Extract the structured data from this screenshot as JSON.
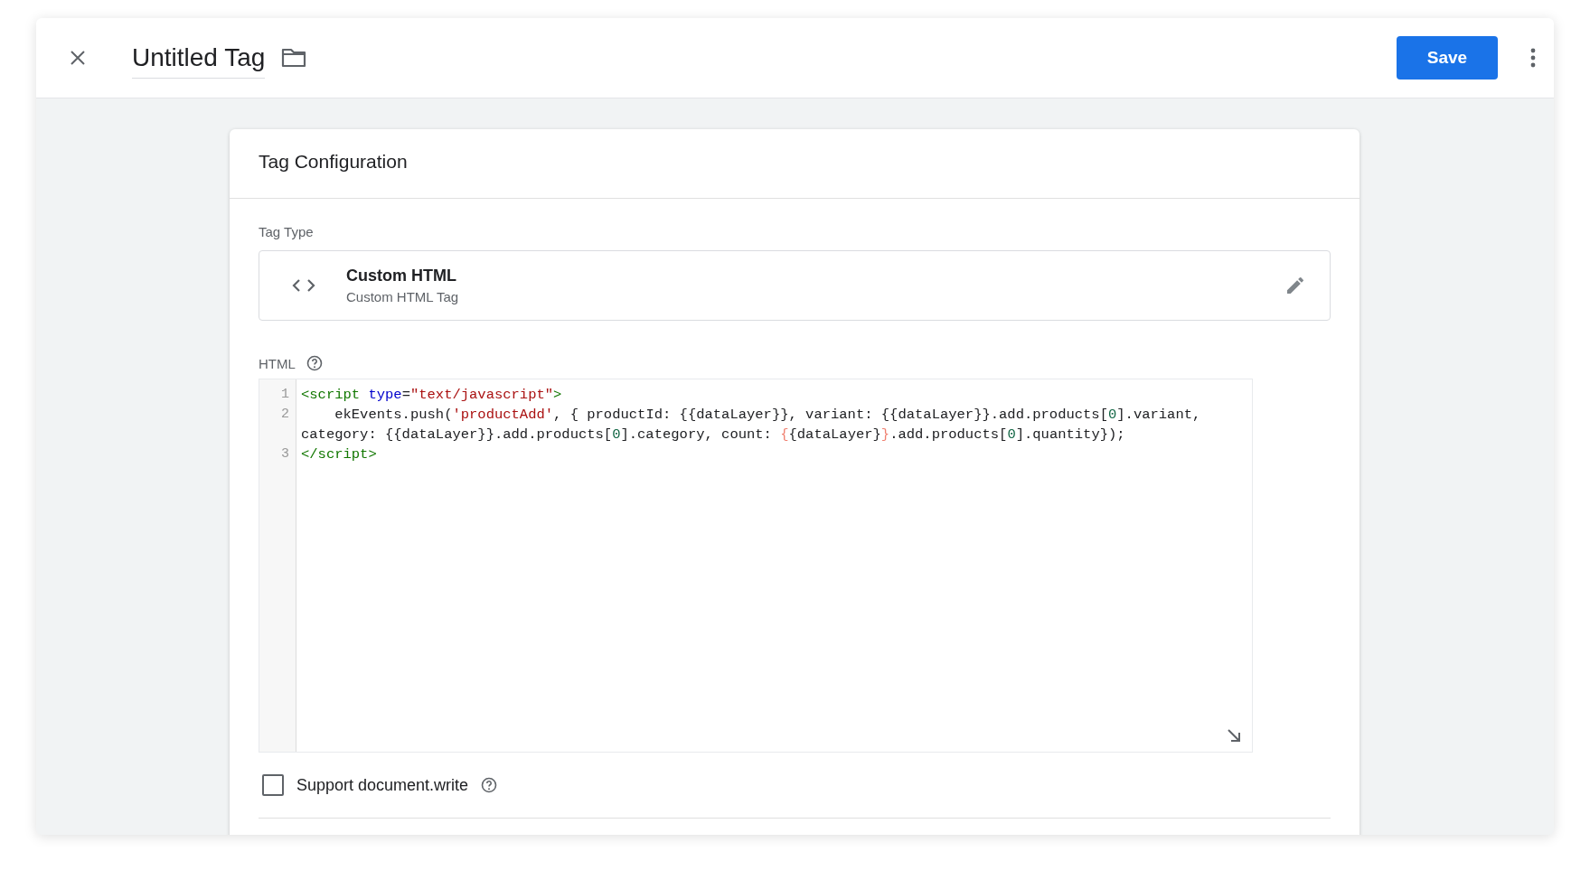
{
  "header": {
    "title": "Untitled Tag",
    "save_label": "Save"
  },
  "card": {
    "title": "Tag Configuration",
    "tag_type_label": "Tag Type",
    "tag_type": {
      "name": "Custom HTML",
      "description": "Custom HTML Tag"
    },
    "html_label": "HTML",
    "code_lines": [
      {
        "number": "1",
        "rows": [
          {
            "tokens": [
              {
                "kind": "tag",
                "text": "<script "
              },
              {
                "kind": "attr",
                "text": "type"
              },
              {
                "kind": "plain",
                "text": "="
              },
              {
                "kind": "string",
                "text": "\"text/javascript\""
              },
              {
                "kind": "tag",
                "text": ">"
              }
            ]
          }
        ]
      },
      {
        "number": "2",
        "rows": [
          {
            "tokens": [
              {
                "kind": "plain",
                "text": "    ekEvents.push("
              },
              {
                "kind": "string",
                "text": "'productAdd'"
              },
              {
                "kind": "plain",
                "text": ", { productId: {{dataLayer}}, variant: {{dataLayer}}.add.products["
              },
              {
                "kind": "number",
                "text": "0"
              },
              {
                "kind": "plain",
                "text": "].variant,"
              }
            ]
          },
          {
            "tokens": [
              {
                "kind": "plain",
                "text": "category: {{dataLayer}}.add.products["
              },
              {
                "kind": "number",
                "text": "0"
              },
              {
                "kind": "plain",
                "text": "].category, count: "
              },
              {
                "kind": "mismatch",
                "text": "{"
              },
              {
                "kind": "plain",
                "text": "{dataLayer}"
              },
              {
                "kind": "mismatch",
                "text": "}"
              },
              {
                "kind": "plain",
                "text": ".add.products["
              },
              {
                "kind": "number",
                "text": "0"
              },
              {
                "kind": "plain",
                "text": "].quantity});"
              }
            ]
          }
        ]
      },
      {
        "number": "3",
        "rows": [
          {
            "tokens": [
              {
                "kind": "tag",
                "text": "</script>"
              }
            ]
          }
        ]
      }
    ],
    "support_document_write": {
      "label": "Support document.write",
      "checked": false
    }
  }
}
